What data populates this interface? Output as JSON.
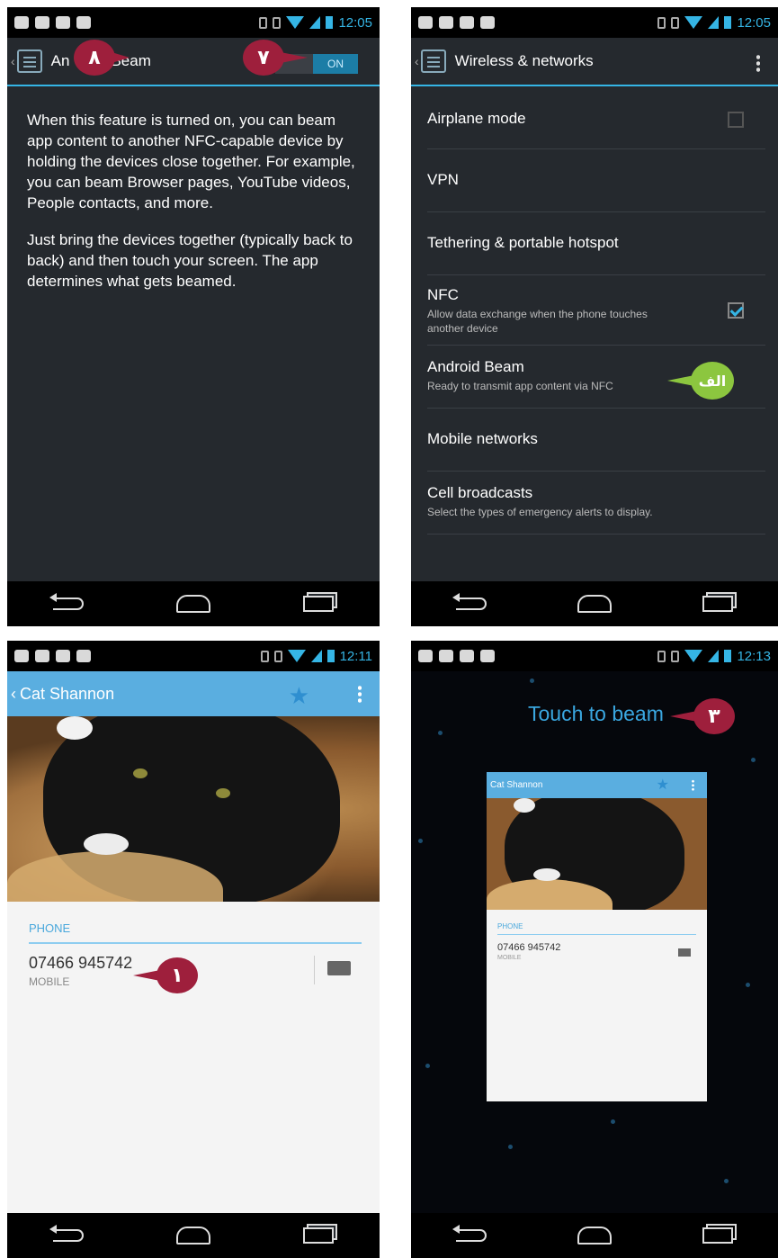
{
  "status_bar": {
    "time_1": "12:05",
    "time_2": "12:05",
    "time_3": "12:11",
    "time_4": "12:13"
  },
  "screen_beam": {
    "title": "Beam",
    "title_obscured_prefix": "An",
    "toggle_label": "ON",
    "description_1": "When this feature is turned on, you can beam app content to another NFC-capable device by holding the devices close together. For example, you can beam Browser pages, YouTube videos, People contacts, and more.",
    "description_2": "Just bring the devices together (typically back to back) and then touch your screen. The app determines what gets beamed."
  },
  "screen_wireless": {
    "title": "Wireless & networks",
    "items": [
      {
        "label": "Airplane mode",
        "sub": "",
        "checkbox": "unchecked"
      },
      {
        "label": "VPN",
        "sub": ""
      },
      {
        "label": "Tethering & portable hotspot",
        "sub": ""
      },
      {
        "label": "NFC",
        "sub": "Allow data exchange when the phone touches another device",
        "checkbox": "checked"
      },
      {
        "label": "Android Beam",
        "sub": "Ready to transmit app content via NFC"
      },
      {
        "label": "Mobile networks",
        "sub": ""
      },
      {
        "label": "Cell broadcasts",
        "sub": "Select the types of emergency alerts to display."
      }
    ]
  },
  "screen_contact": {
    "name": "Cat Shannon",
    "section_header": "PHONE",
    "phone_number": "07466 945742",
    "phone_type": "MOBILE"
  },
  "screen_touch_beam": {
    "prompt": "Touch to beam",
    "mini_name": "Cat Shannon",
    "mini_header": "PHONE",
    "mini_number": "07466 945742",
    "mini_type": "MOBILE"
  },
  "callouts": {
    "c8": "٨",
    "c7": "٧",
    "alef": "الف",
    "c1": "١",
    "c3": "٣"
  },
  "colors": {
    "holo_blue": "#35b5e5",
    "callout_red": "#9e1f3c",
    "callout_green": "#8cc63f",
    "contact_bar": "#5aaee0"
  }
}
